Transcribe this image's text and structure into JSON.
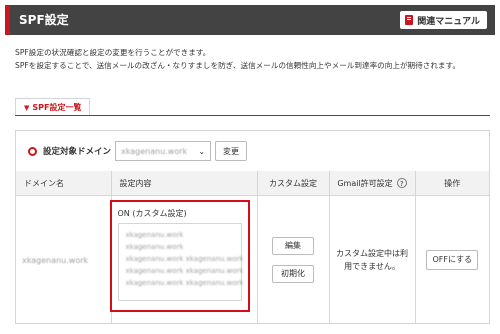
{
  "header": {
    "title": "SPF設定",
    "manual_label": "関連マニュアル"
  },
  "description": [
    "SPF設定の状況確認と設定の変更を行うことができます。",
    "SPFを設定することで、送信メールの改ざん・なりすましを防ぎ、送信メールの信頼性向上やメール到達率の向上が期待されます。"
  ],
  "tab": {
    "label": "SPF設定一覧"
  },
  "domain_selector": {
    "label": "設定対象ドメイン",
    "selected": "xkagenanu.work",
    "change_label": "変更"
  },
  "table": {
    "headers": [
      "ドメイン名",
      "設定内容",
      "カスタム設定",
      "Gmail許可設定",
      "操作"
    ],
    "row": {
      "domain": "xkagenanu.work",
      "status": "ON (カスタム設定)",
      "spf_lines": [
        "xkagenanu.work",
        "xkagenanu.work",
        "xkagenanu.work xkagenanu.work",
        "xkagenanu.work xkagenanu.work",
        "xkagenanu.work xkagenanu.work"
      ],
      "edit_label": "編集",
      "reset_label": "初期化",
      "gmail_note": "カスタム設定中は利用できません。",
      "action_label": "OFFにする"
    }
  },
  "colors": {
    "accent": "#c8171e",
    "header_bg": "#434343",
    "highlight": "#d70c19"
  },
  "icons": {
    "manual": "book-icon",
    "tab": "chevron-down-icon",
    "help": "help-icon",
    "select": "chevron-down-icon"
  }
}
